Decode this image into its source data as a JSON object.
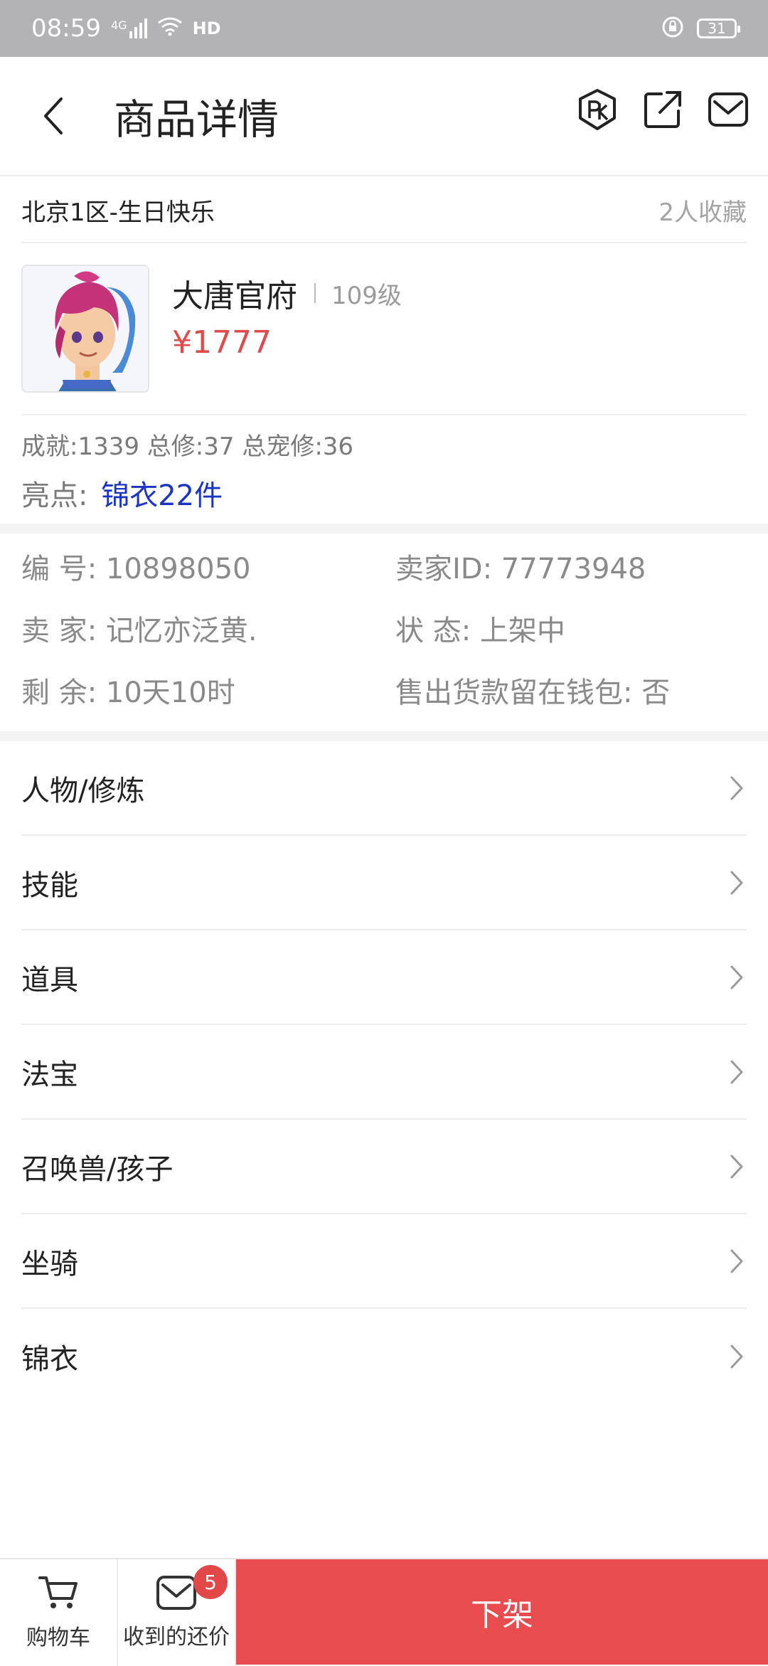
{
  "status_bar": {
    "time": "08:59",
    "network": "4G",
    "hd": "HD",
    "battery": "31"
  },
  "header": {
    "title": "商品详情",
    "icons": [
      "back-icon",
      "pk-icon",
      "share-icon",
      "message-icon"
    ]
  },
  "server": {
    "name": "北京1区-生日快乐",
    "favorites": "2人收藏"
  },
  "character": {
    "school": "大唐官府",
    "level": "109级",
    "price": "¥1777",
    "stats": "成就:1339 总修:37 总宠修:36",
    "highlight_label": "亮点:",
    "highlight_value": "锦衣22件"
  },
  "details": [
    {
      "left": "编  号: 10898050",
      "right": "卖家ID: 77773948"
    },
    {
      "left": "卖  家: 记忆亦泛黄.",
      "right": "状  态: 上架中"
    },
    {
      "left": "剩  余: 10天10时",
      "right": "售出货款留在钱包: 否"
    }
  ],
  "menu": [
    {
      "label": "人物/修炼"
    },
    {
      "label": "技能"
    },
    {
      "label": "道具"
    },
    {
      "label": "法宝"
    },
    {
      "label": "召唤兽/孩子"
    },
    {
      "label": "坐骑"
    },
    {
      "label": "锦衣"
    }
  ],
  "bottom_bar": {
    "cart_label": "购物车",
    "offers_label": "收到的还价",
    "offers_badge": "5",
    "action_label": "下架"
  },
  "colors": {
    "accent": "#e84c4e",
    "price": "#e04a4a",
    "highlight": "#1a35c6"
  }
}
